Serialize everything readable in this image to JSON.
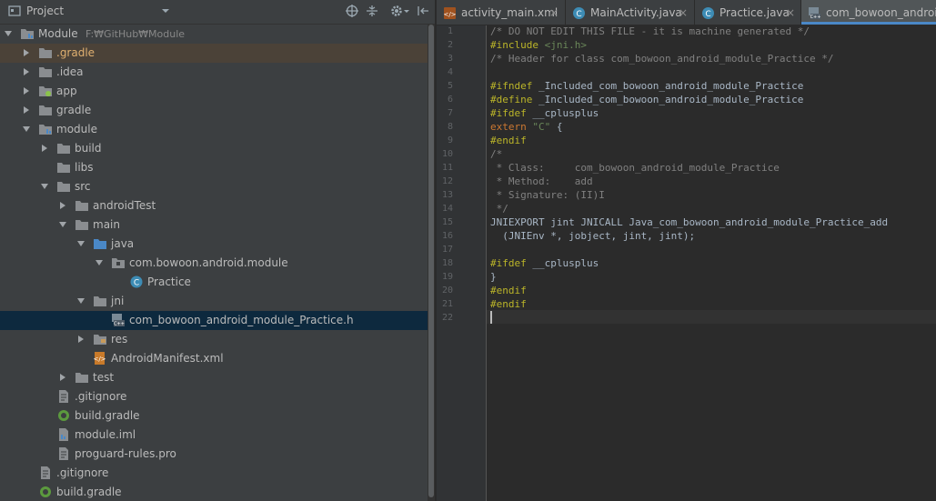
{
  "project_panel": {
    "title": "Project",
    "tree": [
      {
        "label": "Module",
        "path": "F:₩GitHub₩Module",
        "icon": "module-folder-icon"
      },
      {
        "label": ".gradle",
        "icon": "folder-icon"
      },
      {
        "label": ".idea",
        "icon": "folder-icon"
      },
      {
        "label": "app",
        "icon": "android-module-folder-icon"
      },
      {
        "label": "gradle",
        "icon": "folder-icon"
      },
      {
        "label": "module",
        "icon": "module-folder-icon"
      },
      {
        "label": "build",
        "icon": "folder-icon"
      },
      {
        "label": "libs",
        "icon": "folder-icon"
      },
      {
        "label": "src",
        "icon": "folder-icon"
      },
      {
        "label": "androidTest",
        "icon": "folder-icon"
      },
      {
        "label": "main",
        "icon": "folder-icon"
      },
      {
        "label": "java",
        "icon": "source-folder-icon"
      },
      {
        "label": "com.bowoon.android.module",
        "icon": "package-icon"
      },
      {
        "label": "Practice",
        "icon": "java-class-icon"
      },
      {
        "label": "jni",
        "icon": "folder-icon"
      },
      {
        "label": "com_bowoon_android_module_Practice.h",
        "icon": "header-file-icon"
      },
      {
        "label": "res",
        "icon": "resource-folder-icon"
      },
      {
        "label": "AndroidManifest.xml",
        "icon": "manifest-file-icon"
      },
      {
        "label": "test",
        "icon": "folder-icon"
      },
      {
        "label": ".gitignore",
        "icon": "text-file-icon"
      },
      {
        "label": "build.gradle",
        "icon": "gradle-file-icon"
      },
      {
        "label": "module.iml",
        "icon": "iml-file-icon"
      },
      {
        "label": "proguard-rules.pro",
        "icon": "text-file-icon"
      },
      {
        "label": ".gitignore",
        "icon": "text-file-icon"
      },
      {
        "label": "build.gradle",
        "icon": "gradle-file-icon"
      }
    ]
  },
  "tabs": [
    {
      "label": "activity_main.xml",
      "icon": "xml-file-icon",
      "close": "×"
    },
    {
      "label": "MainActivity.java",
      "icon": "java-class-icon",
      "close": "×"
    },
    {
      "label": "Practice.java",
      "icon": "java-class-icon",
      "close": "×"
    },
    {
      "label": "com_bowoon_android_module_Practice.h",
      "icon": "header-file-icon",
      "active": true
    }
  ],
  "editor": {
    "line_numbers": [
      "1",
      "2",
      "3",
      "4",
      "5",
      "6",
      "7",
      "8",
      "9",
      "10",
      "11",
      "12",
      "13",
      "14",
      "15",
      "16",
      "17",
      "18",
      "19",
      "20",
      "21",
      "22"
    ],
    "lines": [
      "/* DO NOT EDIT THIS FILE - it is machine generated */",
      "#include <jni.h>",
      "/* Header for class com_bowoon_android_module_Practice */",
      "",
      "#ifndef _Included_com_bowoon_android_module_Practice",
      "#define _Included_com_bowoon_android_module_Practice",
      "#ifdef __cplusplus",
      "extern \"C\" {",
      "#endif",
      "/*",
      " * Class:     com_bowoon_android_module_Practice",
      " * Method:    add",
      " * Signature: (II)I",
      " */",
      "JNIEXPORT jint JNICALL Java_com_bowoon_android_module_Practice_add",
      "  (JNIEnv *, jobject, jint, jint);",
      "",
      "#ifdef __cplusplus",
      "}",
      "#endif",
      "#endif",
      ""
    ]
  },
  "colors": {
    "panel_bg": "#3c3f41",
    "editor_bg": "#2b2b2b",
    "selection": "#0d293e",
    "accent": "#4a88c7"
  }
}
